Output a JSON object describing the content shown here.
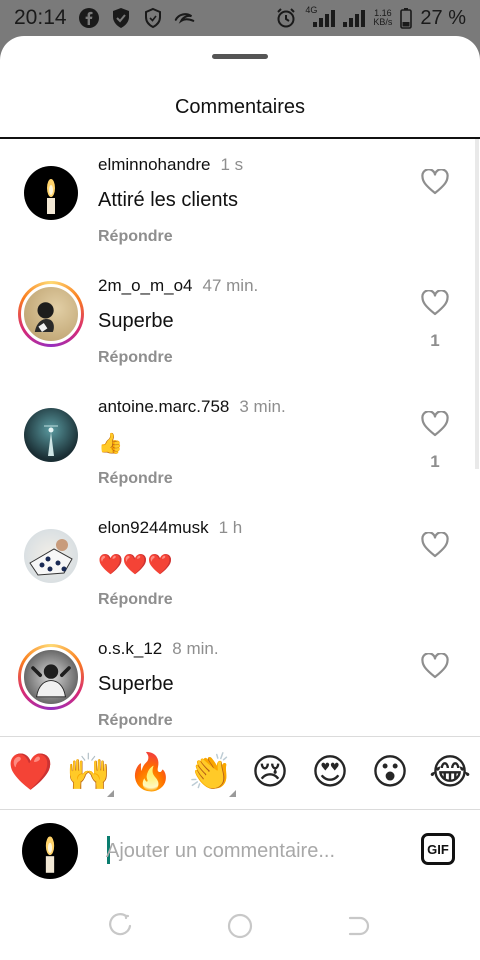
{
  "status_bar": {
    "time": "20:14",
    "network": "4G",
    "speed_value": "1.16",
    "speed_unit": "KB/s",
    "battery": "27 %"
  },
  "sheet": {
    "title": "Commentaires"
  },
  "comments": [
    {
      "username": "elminnohandre",
      "time": "1 s",
      "text": "Attiré les clients",
      "reply_label": "Répondre",
      "likes": "",
      "avatar": "candle",
      "story_ring": false
    },
    {
      "username": "2m_o_m_o4",
      "time": "47 min.",
      "text": "Superbe",
      "reply_label": "Répondre",
      "likes": "1",
      "avatar": "photo-sand",
      "story_ring": true
    },
    {
      "username": "antoine.marc.758",
      "time": "3 min.",
      "text": "👍",
      "reply_label": "Répondre",
      "likes": "1",
      "avatar": "photo-teal",
      "story_ring": false
    },
    {
      "username": "elon9244musk",
      "time": "1 h",
      "text": "❤️❤️❤️",
      "reply_label": "Répondre",
      "likes": "",
      "avatar": "photo-pattern",
      "story_ring": false
    },
    {
      "username": "o.s.k_12",
      "time": "8 min.",
      "text": "Superbe",
      "reply_label": "Répondre",
      "likes": "",
      "avatar": "photo-bw",
      "story_ring": true
    }
  ],
  "emoji_bar": {
    "emojis": [
      "❤️",
      "🙌",
      "🔥",
      "👏",
      "😢",
      "😍",
      "😮",
      "😂"
    ]
  },
  "composer": {
    "placeholder": "Ajouter un commentaire...",
    "value": "",
    "gif_label": "GIF"
  }
}
